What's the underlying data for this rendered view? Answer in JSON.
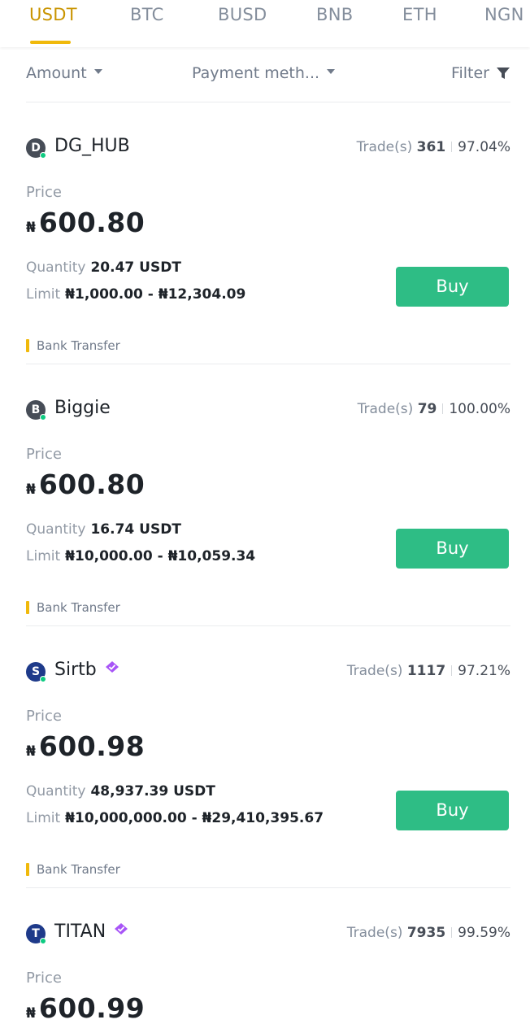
{
  "tabs": [
    {
      "label": "USDT",
      "active": true
    },
    {
      "label": "BTC",
      "active": false
    },
    {
      "label": "BUSD",
      "active": false
    },
    {
      "label": "BNB",
      "active": false
    },
    {
      "label": "ETH",
      "active": false
    },
    {
      "label": "NGN",
      "active": false
    }
  ],
  "filters": {
    "amount": "Amount",
    "payment": "Payment meth...",
    "filter": "Filter"
  },
  "labels": {
    "trades": "Trade(s)",
    "price": "Price",
    "quantity": "Quantity",
    "limit": "Limit",
    "buy": "Buy",
    "currency": "₦"
  },
  "ads": [
    {
      "initial": "D",
      "name": "DG_HUB",
      "verified": false,
      "trades": "361",
      "completion": "97.04%",
      "price": "600.80",
      "quantity": "20.47 USDT",
      "limit": "₦1,000.00 - ₦12,304.09",
      "method": "Bank Transfer"
    },
    {
      "initial": "B",
      "name": "Biggie",
      "verified": false,
      "trades": "79",
      "completion": "100.00%",
      "price": "600.80",
      "quantity": "16.74 USDT",
      "limit": "₦10,000.00 - ₦10,059.34",
      "method": "Bank Transfer"
    },
    {
      "initial": "S",
      "name": "Sirtb",
      "verified": true,
      "trades": "1117",
      "completion": "97.21%",
      "price": "600.98",
      "quantity": "48,937.39 USDT",
      "limit": "₦10,000,000.00 - ₦29,410,395.67",
      "method": "Bank Transfer"
    },
    {
      "initial": "T",
      "name": "TITAN",
      "verified": true,
      "trades": "7935",
      "completion": "99.59%",
      "price": "600.99",
      "quantity": "",
      "limit": "",
      "method": ""
    }
  ],
  "colors": {
    "accent": "#f0b90b",
    "buy": "#2ebd85",
    "avatar_blue": "#1e3a8a",
    "avatar_gray": "#474d57",
    "verified": "#a855f7"
  }
}
